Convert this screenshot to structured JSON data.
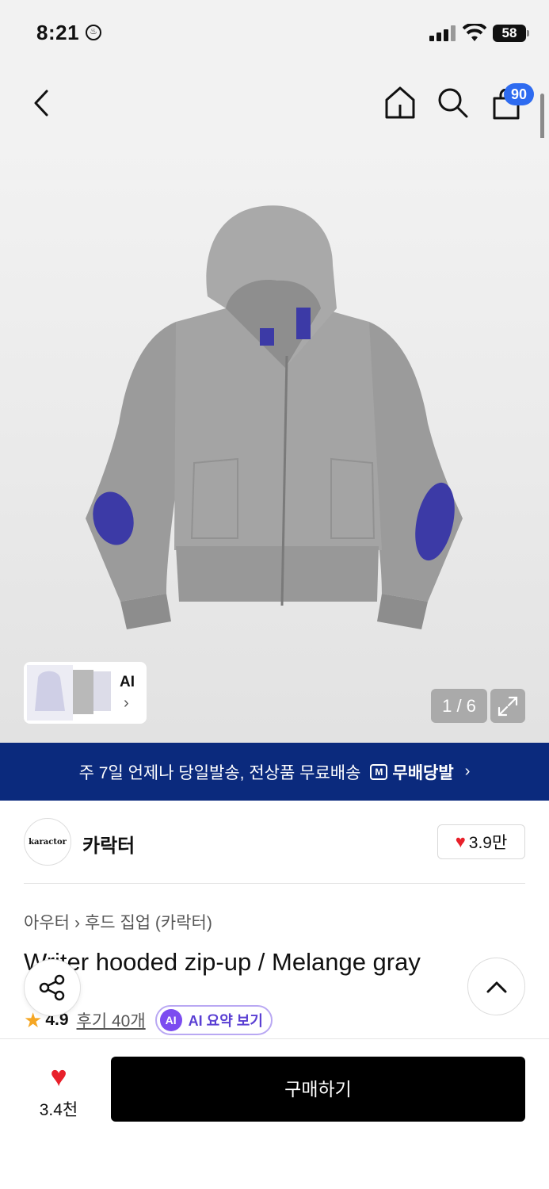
{
  "status_bar": {
    "time": "8:21",
    "battery": "58"
  },
  "nav": {
    "cart_count": "90"
  },
  "gallery": {
    "thumb_label": "AI",
    "counter": "1 / 6"
  },
  "banner": {
    "text": "주 7일 언제나 당일발송, 전상품 무료배송",
    "badge": "무배당발"
  },
  "brand": {
    "logo_text": "karactor",
    "name": "카락터",
    "likes": "3.9만"
  },
  "breadcrumb": {
    "category": "아우터",
    "subcategory": "후드 집업 (카락터)"
  },
  "product": {
    "title": "Writer hooded zip-up / Melange gray"
  },
  "rating": {
    "value": "4.9",
    "reviews": "후기 40개",
    "ai_summary": "AI 요약 보기",
    "ai_badge": "AI"
  },
  "bottom": {
    "wish_count": "3.4천",
    "buy_label": "구매하기"
  },
  "colors": {
    "brand_blue": "#0b2a7d",
    "badge_blue": "#2e6bf0",
    "heart_red": "#e8202a",
    "ai_purple": "#7c4cf0"
  }
}
